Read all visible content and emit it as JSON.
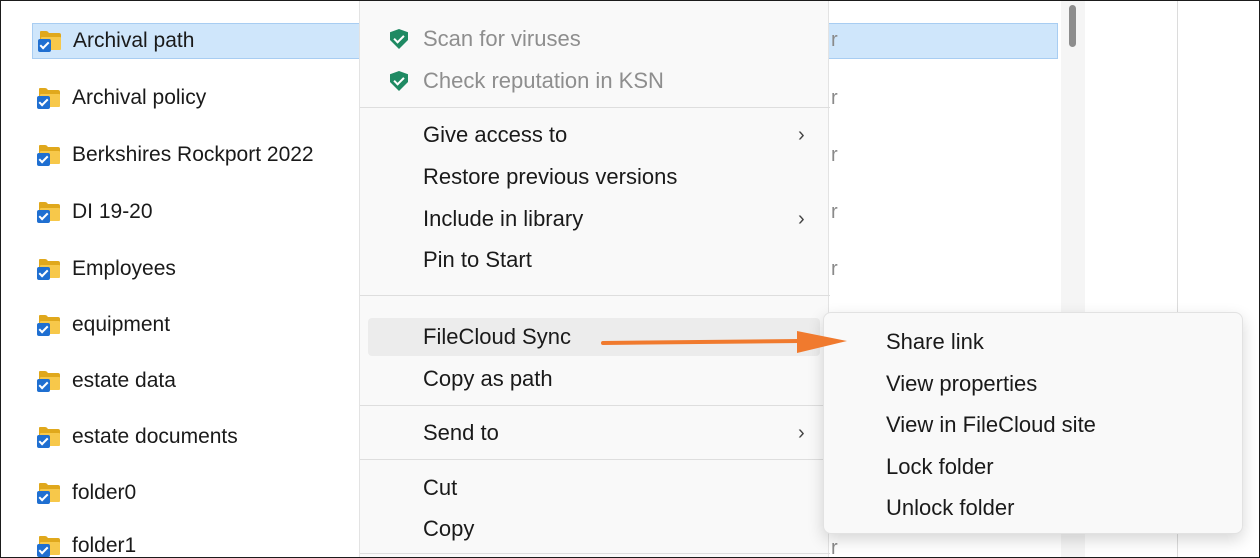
{
  "files": [
    {
      "name": "Archival path",
      "selected": true,
      "trail": "r"
    },
    {
      "name": "Archival policy",
      "selected": false,
      "trail": "r"
    },
    {
      "name": "Berkshires Rockport 2022",
      "selected": false,
      "trail": "r"
    },
    {
      "name": "DI 19-20",
      "selected": false,
      "trail": "r"
    },
    {
      "name": "Employees",
      "selected": false,
      "trail": "r"
    },
    {
      "name": "equipment",
      "selected": false,
      "trail": ""
    },
    {
      "name": "estate data",
      "selected": false,
      "trail": ""
    },
    {
      "name": "estate documents",
      "selected": false,
      "trail": ""
    },
    {
      "name": "folder0",
      "selected": false,
      "trail": ""
    },
    {
      "name": "folder1",
      "selected": false,
      "trail": "r"
    }
  ],
  "context_menu": {
    "scan_viruses": "Scan for viruses",
    "check_reputation": "Check reputation in KSN",
    "give_access": "Give access to",
    "restore_versions": "Restore previous versions",
    "include_library": "Include in library",
    "pin_start": "Pin to Start",
    "filecloud_sync": "FileCloud Sync",
    "copy_path": "Copy as path",
    "send_to": "Send to",
    "cut": "Cut",
    "copy": "Copy",
    "chevron": "›"
  },
  "submenu": {
    "share_link": "Share link",
    "view_properties": "View properties",
    "view_site": "View in FileCloud site",
    "lock_folder": "Lock folder",
    "unlock_folder": "Unlock folder"
  },
  "colors": {
    "selection": "#cfe6fb",
    "folder": "#f7c84a",
    "shield": "#1f8a63",
    "arrow": "#f07a2e"
  },
  "icons": [
    "folder-icon",
    "shield-icon",
    "chevron-right-icon",
    "arrow-annotation"
  ]
}
